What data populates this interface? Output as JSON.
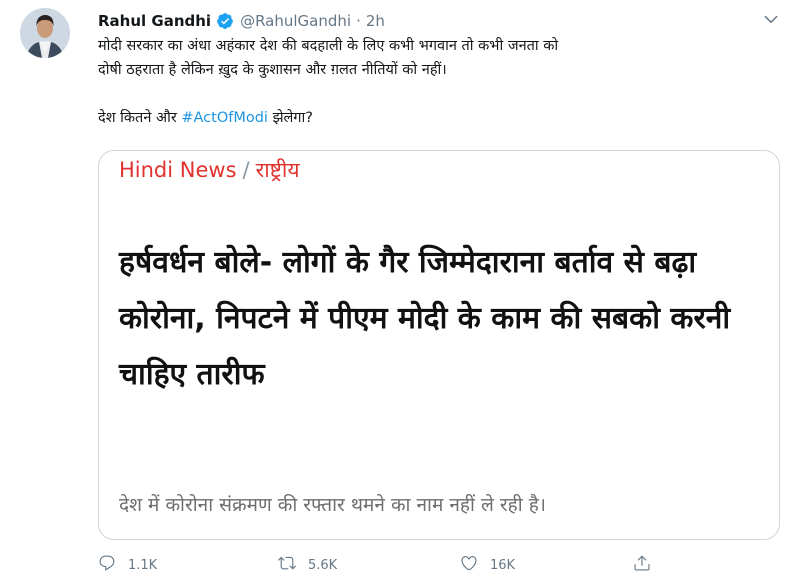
{
  "user": {
    "name": "Rahul Gandhi",
    "handle": "@RahulGandhi",
    "separator": "·",
    "time": "2h"
  },
  "tweet": {
    "line1": "मोदी सरकार का अंधा अहंकार देश की बदहाली के लिए कभी भगवान तो कभी जनता को",
    "line2": "दोषी ठहराता है लेकिन ख़ुद के कुशासन और ग़लत नीतियों को नहीं।",
    "line3_before": "देश कितने और ",
    "hashtag": "#ActOfModi",
    "line3_after": " झेलेगा?"
  },
  "card": {
    "source_name": "Hindi News",
    "source_separator": "/",
    "source_section": "राष्ट्रीय",
    "headline": "हर्षवर्धन बोले- लोगों के गैर जिम्मेदाराना बर्ताव से बढ़ा कोरोना, निपटने में पीएम मोदी के काम की सबको करनी चाहिए तारीफ",
    "summary": "देश में कोरोना संक्रमण की रफ्तार थमने का नाम नहीं ले रही है।"
  },
  "actions": {
    "replies": "1.1K",
    "retweets": "5.6K",
    "likes": "16K"
  },
  "colors": {
    "hashtag": "#1b95e0",
    "source_red": "#e0332f",
    "verified": "#1da1f2",
    "meta_gray": "#657786"
  },
  "icons": [
    "verified-badge-icon",
    "chevron-down-icon",
    "reply-icon",
    "retweet-icon",
    "like-icon",
    "share-icon"
  ]
}
